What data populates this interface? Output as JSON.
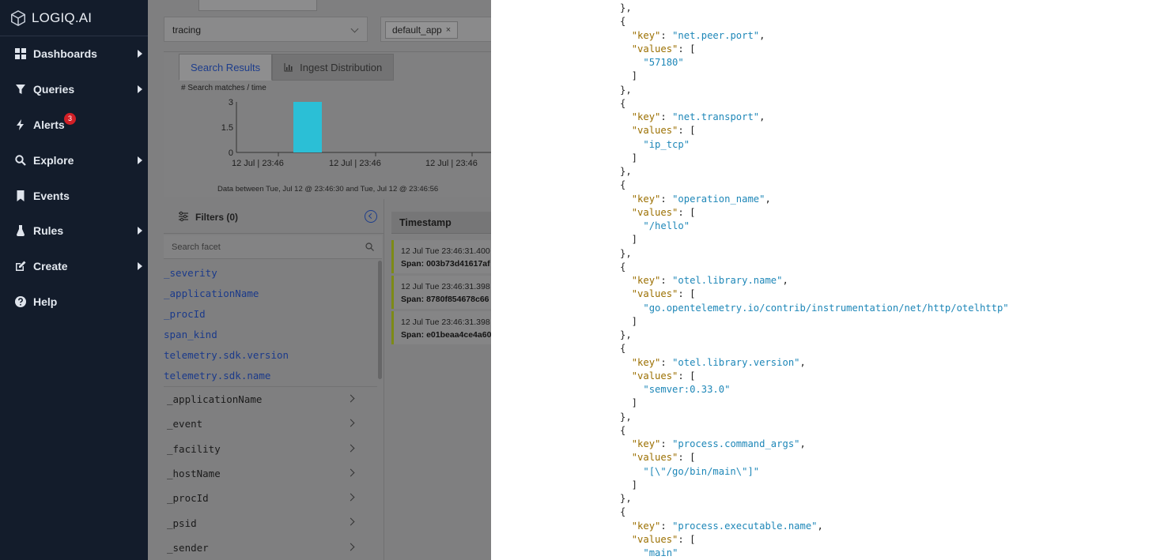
{
  "brand": {
    "name": "LOGIQ.AI",
    "logo_icon": "hexagon-cube-logo"
  },
  "sidebar": {
    "items": [
      {
        "label": "Dashboards",
        "icon": "grid-icon",
        "has_submenu": true
      },
      {
        "label": "Queries",
        "icon": "filter-icon",
        "has_submenu": true
      },
      {
        "label": "Alerts",
        "icon": "bolt-icon",
        "has_submenu": false,
        "badge": "3"
      },
      {
        "label": "Explore",
        "icon": "search-icon",
        "has_submenu": true
      },
      {
        "label": "Events",
        "icon": "bookmark-icon",
        "has_submenu": false
      },
      {
        "label": "Rules",
        "icon": "flask-icon",
        "has_submenu": true
      },
      {
        "label": "Create",
        "icon": "edit-icon",
        "has_submenu": true
      },
      {
        "label": "Help",
        "icon": "help-icon",
        "has_submenu": false
      }
    ]
  },
  "toolbar": {
    "namespace_select": "tracing",
    "app_chip": "default_app",
    "chip_remove": "×"
  },
  "chart_panel": {
    "tabs": [
      {
        "label": "Search Results",
        "active": true
      },
      {
        "label": "Ingest Distribution",
        "active": false
      }
    ],
    "caption": "# Search matches / time",
    "footer": "Data between  Tue, Jul 12 @ 23:46:30  and Tue, Jul 12 @ 23:46:56"
  },
  "chart_data": {
    "type": "bar",
    "title": "# Search matches / time",
    "y_ticks": [
      "3",
      "1.5",
      "0"
    ],
    "ylim": [
      0,
      3
    ],
    "x_ticks": [
      "12 Jul | 23:46",
      "12 Jul | 23:46",
      "12 Jul | 23:46"
    ],
    "bars": [
      {
        "value": 3
      }
    ],
    "bar_color": "#2bbfd6"
  },
  "filters": {
    "title": "Filters (0)",
    "search_placeholder": "Search facet",
    "selected_facets": [
      "_severity",
      "_applicationName",
      "_procId",
      "span_kind",
      "telemetry.sdk.version",
      "telemetry.sdk.name"
    ],
    "facets": [
      "_applicationName",
      "_event",
      "_facility",
      "_hostName",
      "_procId",
      "_psid",
      "_sender"
    ]
  },
  "results": {
    "column_header": "Timestamp",
    "rows": [
      {
        "timestamp": "12 Jul Tue 23:46:31.400",
        "span": "Span: 003b73d41617af"
      },
      {
        "timestamp": "12 Jul Tue 23:46:31.398",
        "span": "Span: 8780f854678c66"
      },
      {
        "timestamp": "12 Jul Tue 23:46:31.398",
        "span": "Span: e01beaa4ce4a60"
      }
    ]
  },
  "json_view": {
    "attributes": [
      {
        "key": "net.peer.port",
        "values": [
          "57180"
        ]
      },
      {
        "key": "net.transport",
        "values": [
          "ip_tcp"
        ]
      },
      {
        "key": "operation_name",
        "values": [
          "/hello"
        ]
      },
      {
        "key": "otel.library.name",
        "values": [
          "go.opentelemetry.io/contrib/instrumentation/net/http/otelhttp"
        ]
      },
      {
        "key": "otel.library.version",
        "values": [
          "semver:0.33.0"
        ]
      },
      {
        "key": "process.command_args",
        "values": [
          "[\\\"/go/bin/main\\\"]"
        ]
      },
      {
        "key": "process.executable.name",
        "values": [
          "main"
        ]
      }
    ]
  },
  "colors": {
    "sidebar_bg": "#131c2b",
    "badge": "#d21f26",
    "json_key": "#9b6f00",
    "json_string": "#1e87b8",
    "link": "#1b3a8a"
  }
}
